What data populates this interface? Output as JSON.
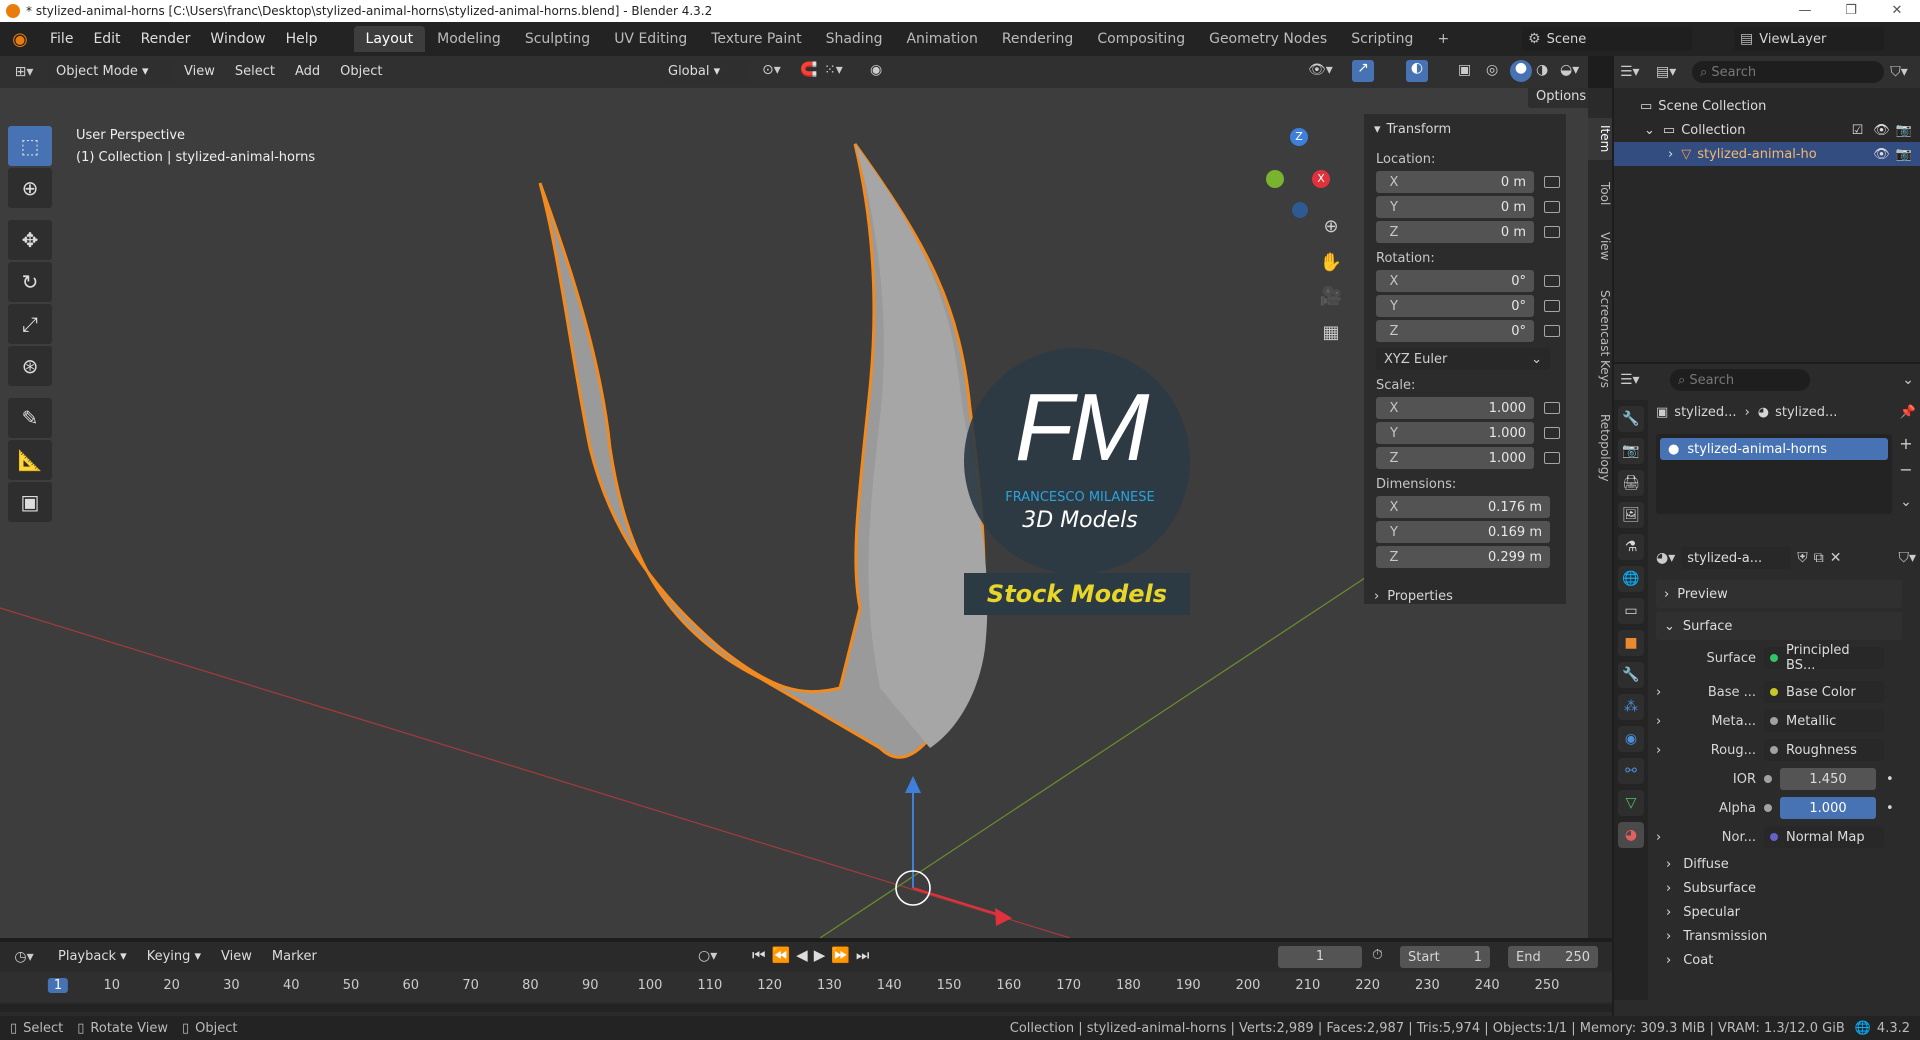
{
  "window": {
    "title": "* stylized-animal-horns [C:\\Users\\franc\\Desktop\\stylized-animal-horns\\stylized-animal-horns.blend] - Blender 4.3.2"
  },
  "menu": [
    "File",
    "Edit",
    "Render",
    "Window",
    "Help"
  ],
  "workspaces": [
    "Layout",
    "Modeling",
    "Sculpting",
    "UV Editing",
    "Texture Paint",
    "Shading",
    "Animation",
    "Rendering",
    "Compositing",
    "Geometry Nodes",
    "Scripting"
  ],
  "scene": {
    "name": "Scene",
    "view_layer": "ViewLayer"
  },
  "viewport_header": {
    "mode": "Object Mode",
    "menus": [
      "View",
      "Select",
      "Add",
      "Object"
    ],
    "orientation": "Global",
    "options_label": "Options"
  },
  "viewport": {
    "perspective": "User Perspective",
    "collection_line": "(1) Collection | stylized-animal-horns"
  },
  "gizmo": {
    "z": "Z",
    "x": "X"
  },
  "watermark": {
    "logo": "FM",
    "brand": "FRANCESCO MILANESE",
    "sub": "3D Models",
    "banner": "Stock Models"
  },
  "transform": {
    "title": "Transform",
    "location_label": "Location:",
    "location": [
      {
        "axis": "X",
        "value": "0 m"
      },
      {
        "axis": "Y",
        "value": "0 m"
      },
      {
        "axis": "Z",
        "value": "0 m"
      }
    ],
    "rotation_label": "Rotation:",
    "rotation": [
      {
        "axis": "X",
        "value": "0°"
      },
      {
        "axis": "Y",
        "value": "0°"
      },
      {
        "axis": "Z",
        "value": "0°"
      }
    ],
    "rotation_mode": "XYZ Euler",
    "scale_label": "Scale:",
    "scale": [
      {
        "axis": "X",
        "value": "1.000"
      },
      {
        "axis": "Y",
        "value": "1.000"
      },
      {
        "axis": "Z",
        "value": "1.000"
      }
    ],
    "dimensions_label": "Dimensions:",
    "dimensions": [
      {
        "axis": "X",
        "value": "0.176 m"
      },
      {
        "axis": "Y",
        "value": "0.169 m"
      },
      {
        "axis": "Z",
        "value": "0.299 m"
      }
    ],
    "properties_label": "Properties"
  },
  "side_tabs": [
    "Item",
    "Tool",
    "View",
    "Screencast Keys",
    "Retopology"
  ],
  "outliner": {
    "search_placeholder": "Search",
    "scene_collection": "Scene Collection",
    "collection": "Collection",
    "object": "stylized-animal-ho"
  },
  "properties": {
    "search_placeholder": "Search",
    "breadcrumb": [
      "stylized...",
      "stylized..."
    ],
    "material_slot": "stylized-animal-horns",
    "material_name": "stylized-a...",
    "sections": {
      "preview": "Preview",
      "surface": "Surface"
    },
    "surface_label": "Surface",
    "surface_shader": "Principled BS...",
    "inputs": [
      {
        "label": "Base ...",
        "value": "Base Color",
        "dot": "#c7c729"
      },
      {
        "label": "Meta...",
        "value": "Metallic",
        "dot": "#a1a1a1"
      },
      {
        "label": "Roug...",
        "value": "Roughness",
        "dot": "#a1a1a1"
      }
    ],
    "ior": {
      "label": "IOR",
      "value": "1.450"
    },
    "alpha": {
      "label": "Alpha",
      "value": "1.000"
    },
    "normal": {
      "label": "Nor...",
      "value": "Normal Map",
      "dot": "#6363c7"
    },
    "subsections": [
      "Diffuse",
      "Subsurface",
      "Specular",
      "Transmission",
      "Coat"
    ]
  },
  "timeline": {
    "menus": [
      "Playback",
      "Keying",
      "View",
      "Marker"
    ],
    "current_frame": "1",
    "start_label": "Start",
    "start": "1",
    "end_label": "End",
    "end": "250",
    "ruler": [
      "1",
      "10",
      "20",
      "30",
      "40",
      "50",
      "60",
      "70",
      "80",
      "90",
      "100",
      "110",
      "120",
      "130",
      "140",
      "150",
      "160",
      "170",
      "180",
      "190",
      "200",
      "210",
      "220",
      "230",
      "240",
      "250"
    ]
  },
  "status": {
    "left": [
      "Select",
      "Rotate View",
      "Object"
    ],
    "right": "Collection | stylized-animal-horns | Verts:2,989 | Faces:2,987 | Tris:5,974 | Objects:1/1 | Memory: 309.3 MiB | VRAM: 1.3/12.0 GiB",
    "version": "4.3.2"
  }
}
